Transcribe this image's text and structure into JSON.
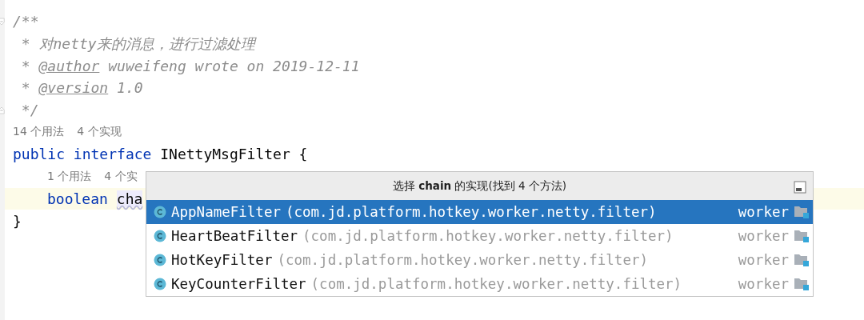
{
  "editor": {
    "lines": [
      {
        "kind": "comment",
        "fold_start": true,
        "tokens": [
          {
            "kind": "text",
            "text": "/**"
          }
        ]
      },
      {
        "kind": "comment",
        "tokens": [
          {
            "kind": "text",
            "text": " * 对netty来的消息，进行过滤处理"
          }
        ]
      },
      {
        "kind": "comment",
        "tokens": [
          {
            "kind": "text",
            "text": " * "
          },
          {
            "kind": "tag",
            "text": "@author"
          },
          {
            "kind": "text",
            "text": " wuweifeng wrote on 2019-12-11"
          }
        ]
      },
      {
        "kind": "comment",
        "tokens": [
          {
            "kind": "text",
            "text": " * "
          },
          {
            "kind": "tag",
            "text": "@version"
          },
          {
            "kind": "text",
            "text": " 1.0"
          }
        ]
      },
      {
        "kind": "comment",
        "fold_end": true,
        "tokens": [
          {
            "kind": "text",
            "text": " */"
          }
        ]
      },
      {
        "kind": "hints",
        "hints": [
          "14 个用法",
          "4 个实现"
        ]
      },
      {
        "kind": "code",
        "tokens": [
          {
            "kind": "keyword",
            "text": "public interface"
          },
          {
            "kind": "plain",
            "text": " INettyMsgFilter {"
          }
        ],
        "children": [
          {
            "kind": "hints",
            "hints": [
              "1 个用法",
              "4 个实"
            ]
          },
          {
            "kind": "code",
            "current": true,
            "tokens": [
              {
                "kind": "keyword",
                "text": "boolean"
              },
              {
                "kind": "highlight",
                "text": "cha"
              }
            ]
          }
        ]
      },
      {
        "kind": "code",
        "tokens": [
          {
            "kind": "plain",
            "text": "}"
          }
        ]
      }
    ]
  },
  "popup": {
    "title": "选择 **chain** 的实现(找到 4 个方法)",
    "rows": [
      {
        "name": "AppNameFilter",
        "package": "(com.jd.platform.hotkey.worker.netty.filter)",
        "module": "worker",
        "selected": true
      },
      {
        "name": "HeartBeatFilter",
        "package": "(com.jd.platform.hotkey.worker.netty.filter)",
        "module": "worker",
        "selected": false
      },
      {
        "name": "HotKeyFilter",
        "package": "(com.jd.platform.hotkey.worker.netty.filter)",
        "module": "worker",
        "selected": false
      },
      {
        "name": "KeyCounterFilter",
        "package": "(com.jd.platform.hotkey.worker.netty.filter)",
        "module": "worker",
        "selected": false
      }
    ]
  }
}
